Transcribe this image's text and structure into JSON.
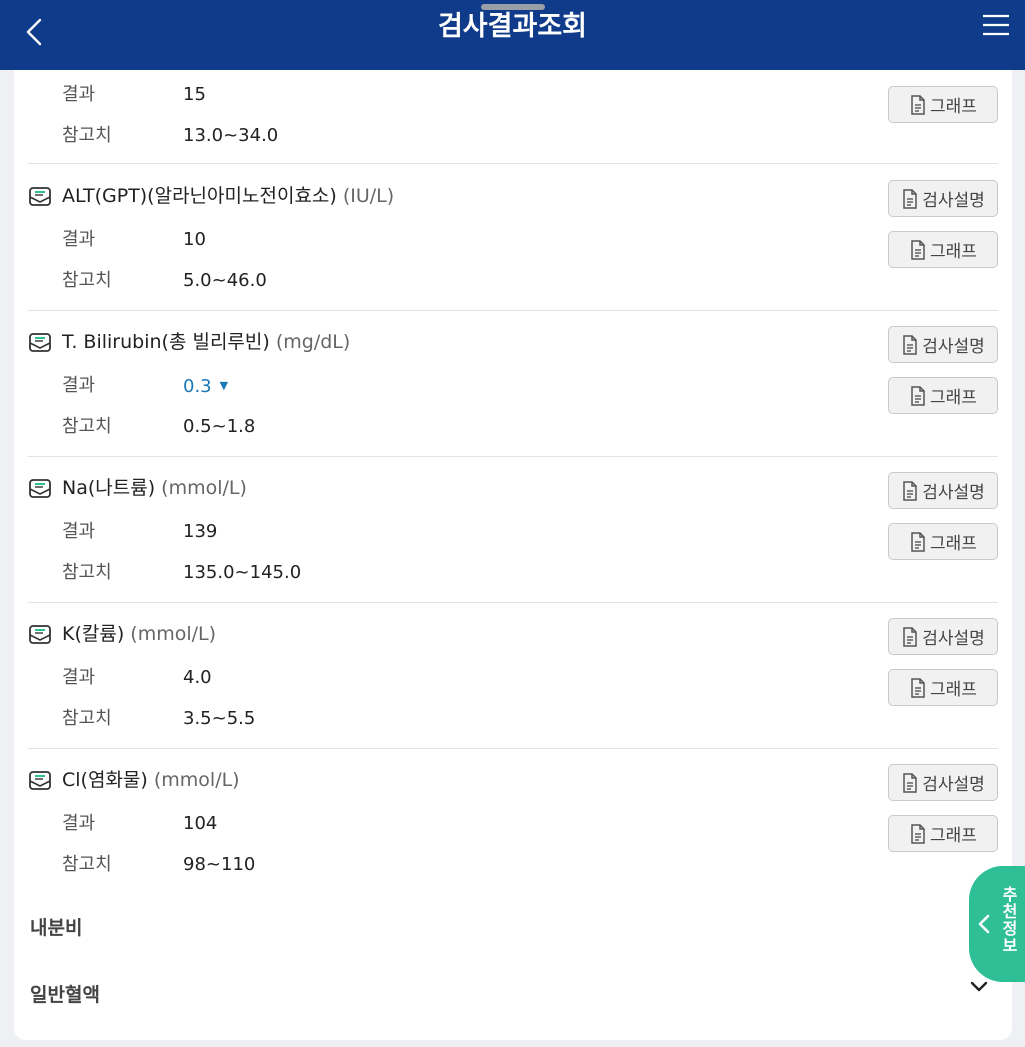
{
  "header": {
    "title": "검사결과조회"
  },
  "labels": {
    "result": "결과",
    "reference": "참고치"
  },
  "buttons": {
    "explain": "검사설명",
    "graph": "그래프"
  },
  "first_item": {
    "result": "15",
    "reference": "13.0~34.0"
  },
  "tests": [
    {
      "name": "ALT(GPT)(알라닌아미노전이효소)",
      "unit": "(IU/L)",
      "result": "10",
      "reference": "5.0~46.0",
      "flag": ""
    },
    {
      "name": "T. Bilirubin(총 빌리루빈)",
      "unit": "(mg/dL)",
      "result": "0.3",
      "reference": "0.5~1.8",
      "flag": "▼"
    },
    {
      "name": "Na(나트륨)",
      "unit": "(mmol/L)",
      "result": "139",
      "reference": "135.0~145.0",
      "flag": ""
    },
    {
      "name": "K(칼륨)",
      "unit": "(mmol/L)",
      "result": "4.0",
      "reference": "3.5~5.5",
      "flag": ""
    },
    {
      "name": "Cl(염화물)",
      "unit": "(mmol/L)",
      "result": "104",
      "reference": "98~110",
      "flag": ""
    }
  ],
  "sections": {
    "endocrine": "내분비",
    "blood": "일반혈액"
  },
  "fab": {
    "label": "추천정보"
  },
  "colors": {
    "header": "#103b8a",
    "low_value": "#1b78b6",
    "fab": "#2ebf97"
  }
}
